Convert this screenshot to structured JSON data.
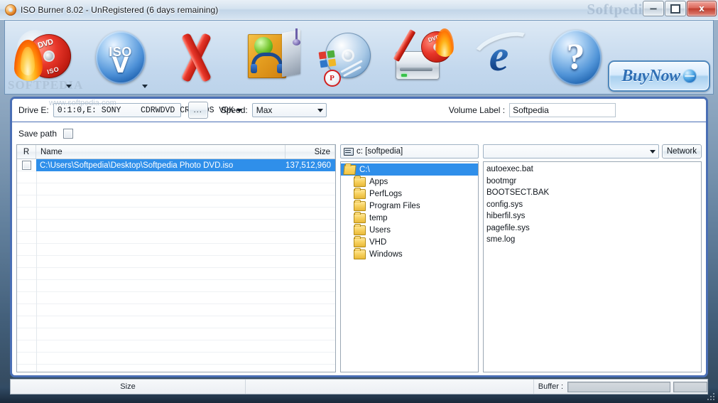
{
  "window": {
    "title": "ISO Burner 8.02 - UnRegistered (6 days remaining)",
    "app_icon": "cd-flame-icon",
    "watermark": "Softpedia",
    "controls": {
      "minimize": "minimize-button",
      "maximize": "maximize-button",
      "close_label": "x"
    }
  },
  "toolbar": {
    "softpedia_mark": "SOFTPEDIA",
    "buttons": [
      {
        "name": "burn-iso-button",
        "icon": "dvd-flame-iso-icon",
        "dropdown": true,
        "dvd_text": "DVD",
        "iso_text": "ISO"
      },
      {
        "name": "create-iso-button",
        "icon": "iso-verify-ball-icon",
        "dropdown": true,
        "line1": "ISO",
        "line2": "V"
      },
      {
        "name": "erase-disc-button",
        "icon": "red-x-icon",
        "dropdown": false
      },
      {
        "name": "media-folder-button",
        "icon": "media-folder-icon",
        "dropdown": false
      },
      {
        "name": "disc-info-button",
        "icon": "disc-windows-icon",
        "dropdown": false,
        "badge": "P"
      },
      {
        "name": "burn-drive-button",
        "icon": "drive-burn-icon",
        "dropdown": false,
        "dvd_text": "DVD"
      },
      {
        "name": "web-button",
        "icon": "internet-explorer-icon",
        "dropdown": false,
        "glyph": "e"
      },
      {
        "name": "help-button",
        "icon": "question-help-icon",
        "dropdown": false,
        "glyph": "?"
      }
    ],
    "buy_now": {
      "label": "BuyNow",
      "icon": "globe-icon"
    }
  },
  "settings": {
    "drive_label": "Drive E:",
    "drive_value": "0:1:0,E: SONY    CDRWDVD CRX310S VDK",
    "browse_label": "...",
    "speed_label": "Speed:",
    "speed_value": "Max",
    "volume_label": "Volume Label :",
    "volume_value": "Softpedia",
    "save_path_label": "Save path",
    "save_path_checked": false,
    "watermark": "www.softpedia.com"
  },
  "filelist": {
    "columns": {
      "check": "R",
      "name": "Name",
      "size": "Size"
    },
    "rows": [
      {
        "checked": false,
        "name": "C:\\Users\\Softpedia\\Desktop\\Softpedia Photo DVD.iso",
        "size": "137,512,960",
        "selected": true
      }
    ]
  },
  "browser": {
    "drive_combo": {
      "value": "c: [softpedia]",
      "icon": "drive-icon"
    },
    "network_button": "Network",
    "tree": [
      {
        "label": "C:\\",
        "icon": "folder-open-icon",
        "selected": true,
        "depth": 0
      },
      {
        "label": "Apps",
        "icon": "folder-icon",
        "selected": false,
        "depth": 1
      },
      {
        "label": "PerfLogs",
        "icon": "folder-icon",
        "selected": false,
        "depth": 1
      },
      {
        "label": "Program Files",
        "icon": "folder-icon",
        "selected": false,
        "depth": 1
      },
      {
        "label": "temp",
        "icon": "folder-icon",
        "selected": false,
        "depth": 1
      },
      {
        "label": "Users",
        "icon": "folder-icon",
        "selected": false,
        "depth": 1
      },
      {
        "label": "VHD",
        "icon": "folder-icon",
        "selected": false,
        "depth": 1
      },
      {
        "label": "Windows",
        "icon": "folder-icon",
        "selected": false,
        "depth": 1
      }
    ],
    "files": [
      "autoexec.bat",
      "bootmgr",
      "BOOTSECT.BAK",
      "config.sys",
      "hiberfil.sys",
      "pagefile.sys",
      "sme.log"
    ]
  },
  "statusbar": {
    "size_label": "Size",
    "buffer_label": "Buffer :",
    "buffer_value": "",
    "buffer_percent": 0
  },
  "colors": {
    "selection": "#2f8fea",
    "panel_border": "#4a6fb5",
    "toolbar_top": "#dde9f5",
    "toolbar_bottom": "#bcd3ea",
    "accent_red": "#e8372a",
    "accent_blue": "#2f6fb5"
  }
}
